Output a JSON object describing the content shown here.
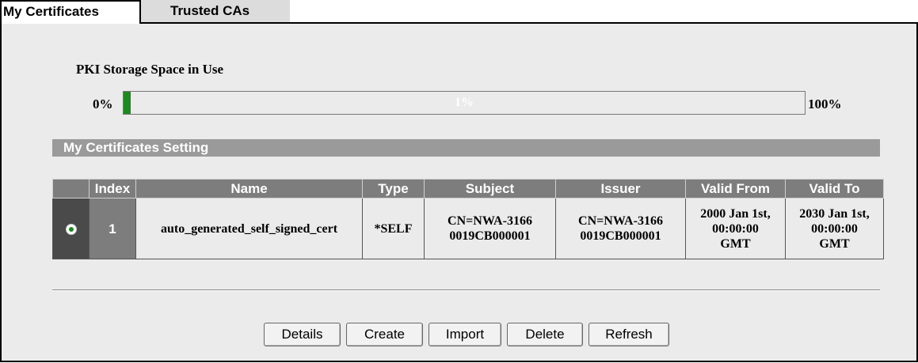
{
  "tabs": [
    {
      "label": "My Certificates",
      "active": true
    },
    {
      "label": "Trusted CAs",
      "active": false
    }
  ],
  "pki": {
    "title": "PKI Storage Space in Use",
    "min_label": "0%",
    "max_label": "100%",
    "usage_percent": 1,
    "usage_label": "1%",
    "fill_color": "#1d8a1d"
  },
  "section": {
    "title": "My Certificates Setting"
  },
  "table": {
    "headers": [
      "",
      "Index",
      "Name",
      "Type",
      "Subject",
      "Issuer",
      "Valid From",
      "Valid To"
    ],
    "rows": [
      {
        "selected": true,
        "index": "1",
        "name": "auto_generated_self_signed_cert",
        "type": "*SELF",
        "subject_line1": "CN=NWA-3166",
        "subject_line2": "0019CB000001",
        "issuer_line1": "CN=NWA-3166",
        "issuer_line2": "0019CB000001",
        "valid_from_line1": "2000 Jan 1st,",
        "valid_from_line2": "00:00:00",
        "valid_from_line3": "GMT",
        "valid_to_line1": "2030 Jan 1st,",
        "valid_to_line2": "00:00:00",
        "valid_to_line3": "GMT"
      }
    ]
  },
  "buttons": {
    "details": "Details",
    "create": "Create",
    "import": "Import",
    "delete": "Delete",
    "refresh": "Refresh"
  }
}
